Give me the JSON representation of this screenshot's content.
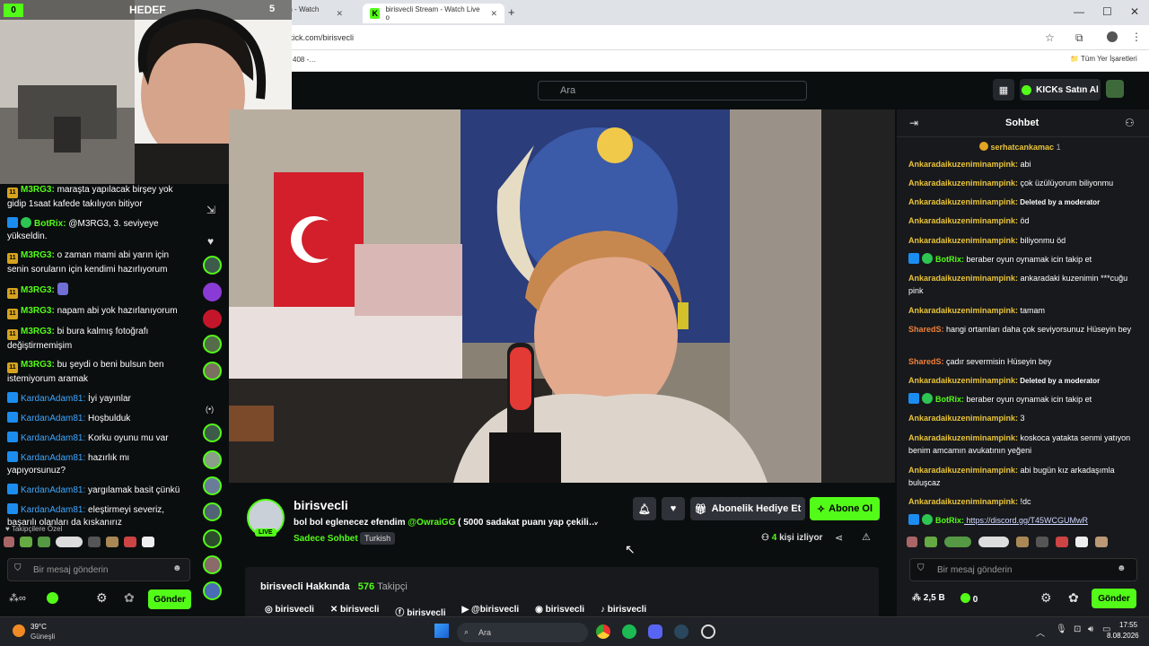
{
  "browser": {
    "tabs": [
      {
        "title": "HEDEF",
        "count": "5"
      },
      {
        "title": "OwraiGG Stream - Watch Live o"
      },
      {
        "title": "birisvecli Stream - Watch Live o"
      }
    ],
    "new_tab": "+",
    "url": "kick.com/birisvecli",
    "url_left": "0  …com/popout/owraigg/ch…",
    "bookmark_left": "408 -…",
    "bookmarks_all": "Tüm Yer İşaretleri"
  },
  "header": {
    "search_placeholder": "Ara",
    "kicks_button": "KICKs Satın Al"
  },
  "webcam": {
    "overlay_label": "HEDEF",
    "count": "0"
  },
  "left_chat": {
    "messages": [
      {
        "user": "M3RG3:",
        "text": " maraşta yapılacak birşey yok gidip 1saat kafede takılıyon bitiyor"
      },
      {
        "user": "BotRix:",
        "text": " @M3RG3, 3. seviyeye yükseldin."
      },
      {
        "user": "M3RG3:",
        "text": " o zaman mami abi yarın için senin soruların için kendimi hazırlıyorum"
      },
      {
        "user": "M3RG3:",
        "text": ""
      },
      {
        "user": "M3RG3:",
        "text": " napam abi yok hazırlanıyorum"
      },
      {
        "user": "M3RG3:",
        "text": " bi bura kalmış fotoğrafı değiştirmemişim"
      },
      {
        "user": "M3RG3:",
        "text": " bu şeydi o beni bulsun ben istemiyorum aramak"
      },
      {
        "user": "KardanAdam81:",
        "text": " İyi yayınlar"
      },
      {
        "user": "KardanAdam81:",
        "text": " Hoşbulduk"
      },
      {
        "user": "KardanAdam81:",
        "text": " Korku oyunu mu var"
      },
      {
        "user": "KardanAdam81:",
        "text": " hazırlık mı yapıyorsunuz?"
      },
      {
        "user": "KardanAdam81:",
        "text": " yargılamak basit çünkü"
      },
      {
        "user": "KardanAdam81:",
        "text": " eleştirmeyi severiz, başarılı olanları da kıskanırız"
      }
    ],
    "followers_special": "Takipçilere Özel",
    "input_placeholder": "Bir mesaj gönderin",
    "send": "Gönder"
  },
  "stream": {
    "channel": "birisvecli",
    "live": "LIVE",
    "title": "bol bol eglenecez efendim",
    "mention": "@OwraiGG",
    "title_rest": " ( 5000 sadakat puanı yap çekili…",
    "category": "Sadece Sohbet",
    "language": "Turkish",
    "gift_button": "Abonelik Hediye Et",
    "subscribe_button": "Abone Ol",
    "viewers": "4",
    "viewers_label": "kişi izliyor",
    "about_title": "birisvecli Hakkında",
    "followers": "576",
    "followers_label": "Takipçi",
    "socials": [
      "birisvecli",
      "birisvecli",
      "birisvecli",
      "@birisvecli",
      "birisvecli",
      "birisvecli"
    ]
  },
  "right_chat": {
    "title": "Sohbet",
    "pinned_user": "serhatcankamac",
    "pinned_count": "1",
    "messages": [
      {
        "user": "Ankaradaikuzeniminampink:",
        "text": " abi"
      },
      {
        "user": "Ankaradaikuzeniminampink:",
        "text": " çok üzülüyorum biliyonmu"
      },
      {
        "user": "Ankaradaikuzeniminampink:",
        "text": " Deleted by a moderator",
        "mod": true
      },
      {
        "user": "Ankaradaikuzeniminampink:",
        "text": " öd"
      },
      {
        "user": "Ankaradaikuzeniminampink:",
        "text": " biliyonmu öd"
      },
      {
        "user": "BotRix:",
        "text": " beraber oyun oynamak icin takip et",
        "bot": true
      },
      {
        "user": "Ankaradaikuzeniminampink:",
        "text": " ankaradaki kuzenimin ***cuğu pink"
      },
      {
        "user": "Ankaradaikuzeniminampink:",
        "text": " tamam"
      },
      {
        "user": "SharedS:",
        "text": " hangi ortamları daha çok seviyorsunuz Hüseyin bey",
        "alt": true
      },
      {
        "user": "SharedS:",
        "text": " çadır severmisin Hüseyin bey",
        "alt": true
      },
      {
        "user": "Ankaradaikuzeniminampink:",
        "text": " Deleted by a moderator",
        "mod": true
      },
      {
        "user": "BotRix:",
        "text": " beraber oyun oynamak icin takip et",
        "bot": true
      },
      {
        "user": "Ankaradaikuzeniminampink:",
        "text": " 3"
      },
      {
        "user": "Ankaradaikuzeniminampink:",
        "text": " koskoca yatakta senmi yatıyon benim amcamın avukatının yeğeni"
      },
      {
        "user": "Ankaradaikuzeniminampink:",
        "text": " abi bugün kız arkadaşımla buluşcaz"
      },
      {
        "user": "Ankaradaikuzeniminampink:",
        "text": " !dc"
      },
      {
        "user": "BotRix:",
        "text": " https://discord.gg/T45WCGUMwR",
        "bot": true,
        "link": true
      }
    ],
    "input_placeholder": "Bir mesaj gönderin",
    "points": "2,5 B",
    "kicks": "0",
    "send": "Gönder"
  },
  "taskbar": {
    "weather_temp": "39°C",
    "weather_desc": "Güneşli",
    "search": "Ara",
    "time": "17:55",
    "date": "8.08.2026"
  },
  "colors": {
    "accent": "#53fc18",
    "bg": "#0b0e0f",
    "chat_bg": "#18191c"
  }
}
